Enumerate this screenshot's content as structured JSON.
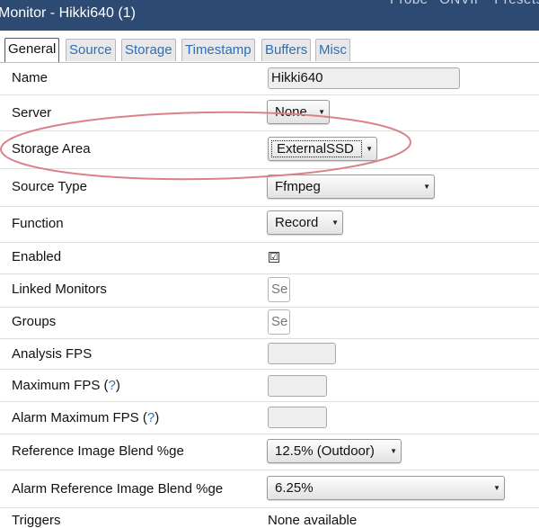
{
  "window": {
    "title": "Monitor - Hikki640 (1)",
    "menu": [
      "Probe",
      "ONVIF",
      "Presets"
    ]
  },
  "tabs": [
    {
      "label": "General",
      "active": true
    },
    {
      "label": "Source",
      "active": false
    },
    {
      "label": "Storage",
      "active": false
    },
    {
      "label": "Timestamp",
      "active": false
    },
    {
      "label": "Buffers",
      "active": false
    },
    {
      "label": "Misc",
      "active": false
    }
  ],
  "fields": {
    "name": {
      "label": "Name",
      "value": "Hikki640"
    },
    "server": {
      "label": "Server",
      "value": "None"
    },
    "storage_area": {
      "label": "Storage Area",
      "value": "ExternalSSD"
    },
    "source_type": {
      "label": "Source Type",
      "value": "Ffmpeg"
    },
    "function": {
      "label": "Function",
      "value": "Record"
    },
    "enabled": {
      "label": "Enabled",
      "checked": true,
      "glyph": "☑"
    },
    "linked_monitors": {
      "label": "Linked Monitors",
      "placeholder": "Se"
    },
    "groups": {
      "label": "Groups",
      "placeholder": "Se"
    },
    "analysis_fps": {
      "label": "Analysis FPS",
      "value": ""
    },
    "maximum_fps": {
      "label": "Maximum FPS (",
      "help": "?",
      "close": ")",
      "value": ""
    },
    "alarm_maximum_fps": {
      "label": "Alarm Maximum FPS (",
      "help": "?",
      "close": ")",
      "value": ""
    },
    "ref_blend": {
      "label": "Reference Image Blend %ge",
      "value": "12.5% (Outdoor)"
    },
    "alarm_ref_blend": {
      "label": "Alarm Reference Image Blend %ge",
      "value": "6.25%"
    },
    "triggers": {
      "label": "Triggers",
      "value": "None available"
    }
  },
  "colors": {
    "titlebar": "#2c4a72",
    "tab_text": "#2f6fb3",
    "annotation_ellipse": "#d9828a"
  },
  "icons": {
    "dropdown": "▼"
  }
}
